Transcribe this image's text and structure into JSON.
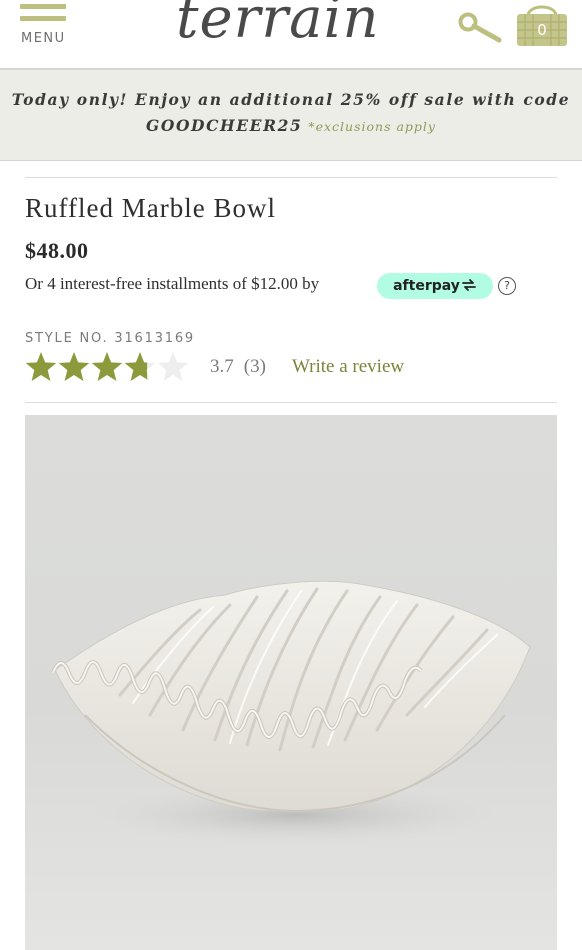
{
  "header": {
    "menu_label": "MENU",
    "logo_text": "terrain",
    "cart_count": "0",
    "accent_color": "#bcbf7e"
  },
  "promo": {
    "line1": "Today only! Enjoy an additional 25% off sale with code",
    "code": "GOODCHEER25",
    "note": "*exclusions apply"
  },
  "product": {
    "title": "Ruffled Marble Bowl",
    "price": "$48.00",
    "installments_text": "Or 4 interest-free installments of $12.00 by",
    "afterpay_label": "afterpay",
    "help_icon": "?",
    "style_no": "STYLE NO. 31613169",
    "rating": "3.7",
    "review_count": "(3)",
    "rating_value": 3.7,
    "rating_max": 5,
    "write_review_label": "Write a review",
    "star_color": "#8c9a3c",
    "empty_star_color": "#eeeeee"
  },
  "icons": {
    "menu": "hamburger-icon",
    "search": "search-icon",
    "cart": "basket-icon",
    "afterpay": "afterpay-arrows-icon",
    "help": "question-circle-icon"
  }
}
